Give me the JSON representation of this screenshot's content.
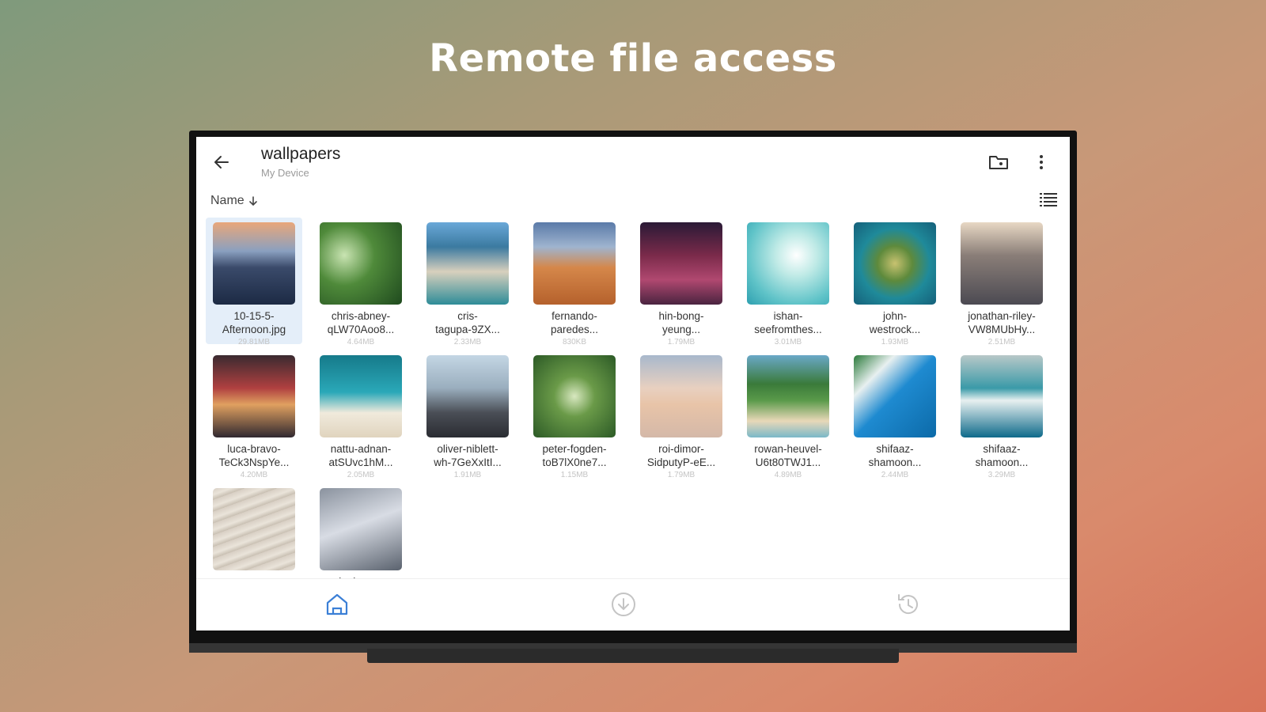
{
  "headline": "Remote file access",
  "appbar": {
    "title": "wallpapers",
    "subtitle": "My Device"
  },
  "sort": {
    "label": "Name",
    "direction": "descending"
  },
  "colors": {
    "accent": "#3b7fd6",
    "selected_bg": "#e4eef9",
    "icon_gray": "#c4c4c4"
  },
  "files": [
    {
      "name": "10-15-5-\nAfternoon.jpg",
      "size": "29.81MB",
      "selected": true
    },
    {
      "name": "chris-abney-\nqLW70Aoo8...",
      "size": "4.64MB"
    },
    {
      "name": "cris-\ntagupa-9ZX...",
      "size": "2.33MB"
    },
    {
      "name": "fernando-\nparedes...",
      "size": "830KB"
    },
    {
      "name": "hin-bong-\nyeung...",
      "size": "1.79MB"
    },
    {
      "name": "ishan-\nseefromthes...",
      "size": "3.01MB"
    },
    {
      "name": "john-\nwestrock...",
      "size": "1.93MB"
    },
    {
      "name": "jonathan-riley-\nVW8MUbHy...",
      "size": "2.51MB"
    },
    {
      "name": "luca-bravo-\nTeCk3NspYe...",
      "size": "4.20MB"
    },
    {
      "name": "nattu-adnan-\natSUvc1hM...",
      "size": "2.05MB"
    },
    {
      "name": "oliver-niblett-\nwh-7GeXxItI...",
      "size": "1.91MB"
    },
    {
      "name": "peter-fogden-\ntoB7lX0ne7...",
      "size": "1.15MB"
    },
    {
      "name": "roi-dimor-\nSidputyP-eE...",
      "size": "1.79MB"
    },
    {
      "name": "rowan-heuvel-\nU6t80TWJ1...",
      "size": "4.89MB"
    },
    {
      "name": "shifaaz-\nshamoon...",
      "size": "2.44MB"
    },
    {
      "name": "shifaaz-\nshamoon...",
      "size": "3.29MB"
    },
    {
      "name": "summer-",
      "size": ""
    },
    {
      "name": "xiaohua-wu",
      "size": ""
    }
  ],
  "bottom_nav": [
    {
      "icon": "home-icon",
      "active": true
    },
    {
      "icon": "download-icon",
      "active": false
    },
    {
      "icon": "history-icon",
      "active": false
    }
  ]
}
